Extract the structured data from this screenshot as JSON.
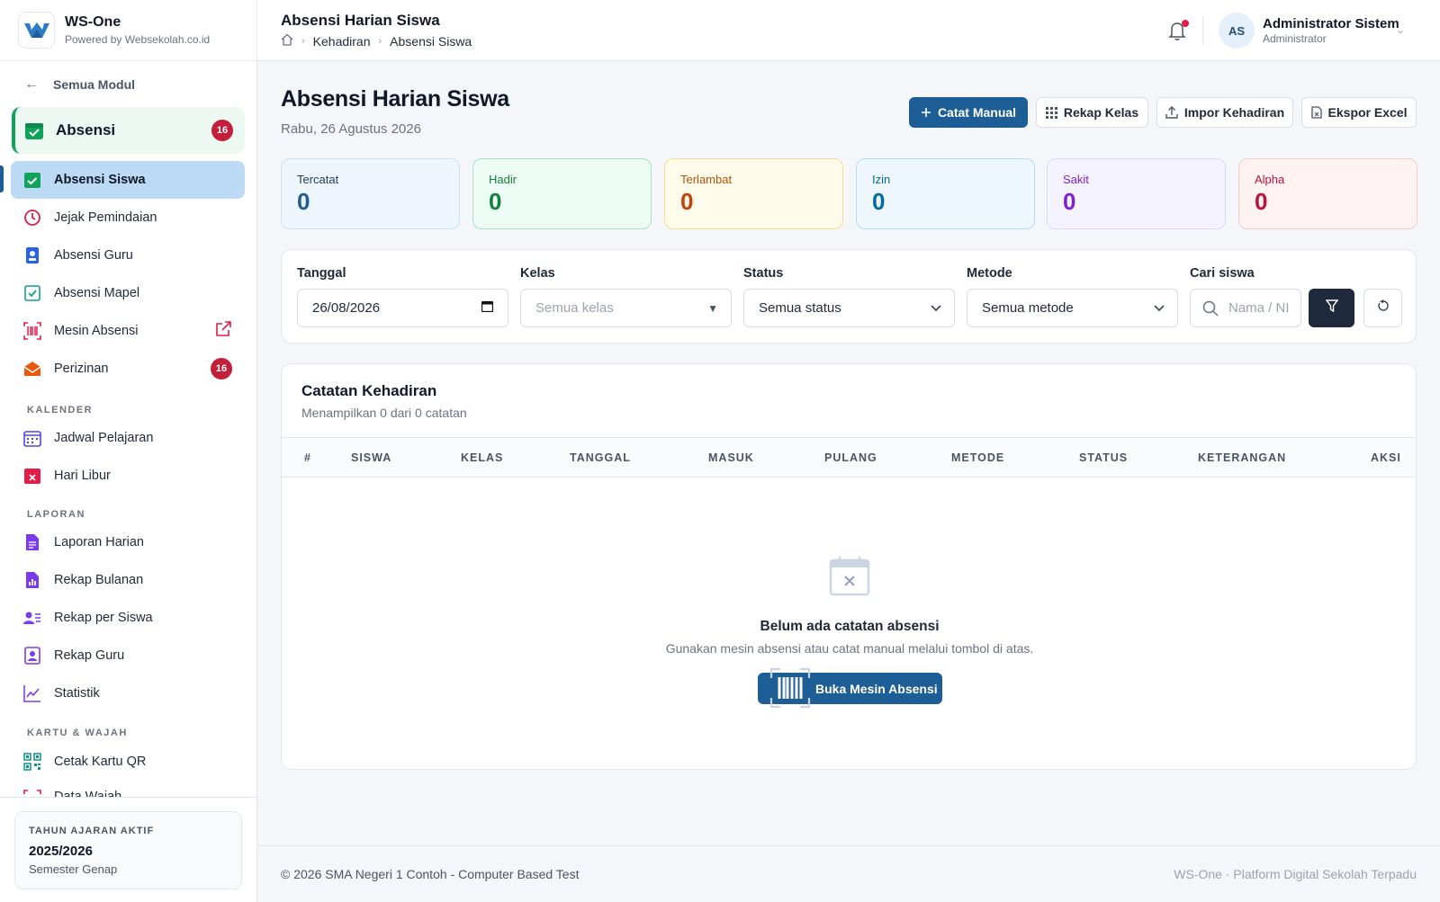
{
  "brand": {
    "name": "WS-One",
    "tagline": "Powered by Websekolah.co.id"
  },
  "sidebar": {
    "back_label": "Semua Modul",
    "module": {
      "label": "Absensi",
      "badge": "16"
    },
    "items": [
      {
        "label": "Absensi Siswa",
        "icon": "calendar-check-icon",
        "active": true
      },
      {
        "label": "Jejak Pemindaian",
        "icon": "clock-icon"
      },
      {
        "label": "Absensi Guru",
        "icon": "id-badge-icon"
      },
      {
        "label": "Absensi Mapel",
        "icon": "checklist-icon"
      },
      {
        "label": "Mesin Absensi",
        "icon": "barcode-scanner-icon"
      },
      {
        "label": "Perizinan",
        "icon": "envelope-open-icon",
        "badge": "16"
      }
    ],
    "section_kalender": "KALENDER",
    "kalender_items": [
      {
        "label": "Jadwal Pelajaran",
        "icon": "calendar-grid-icon"
      },
      {
        "label": "Hari Libur",
        "icon": "calendar-x-icon"
      }
    ],
    "section_laporan": "LAPORAN",
    "laporan_items": [
      {
        "label": "Laporan Harian",
        "icon": "document-icon"
      },
      {
        "label": "Rekap Bulanan",
        "icon": "bar-chart-icon"
      },
      {
        "label": "Rekap per Siswa",
        "icon": "user-list-icon"
      },
      {
        "label": "Rekap Guru",
        "icon": "contact-card-icon"
      },
      {
        "label": "Statistik",
        "icon": "line-chart-icon"
      }
    ],
    "section_kartu": "KARTU & WAJAH",
    "kartu_items": [
      {
        "label": "Cetak Kartu QR",
        "icon": "qr-code-icon"
      },
      {
        "label": "Data Wajah",
        "icon": "face-scan-icon"
      }
    ],
    "year_card": {
      "title": "TAHUN AJARAN AKTIF",
      "value": "2025/2026",
      "semester": "Semester Genap"
    }
  },
  "topbar": {
    "title": "Absensi Harian Siswa",
    "breadcrumb": [
      "Kehadiran",
      "Absensi Siswa"
    ],
    "user": {
      "initials": "AS",
      "name": "Administrator Sistem",
      "role": "Administrator"
    }
  },
  "page": {
    "title": "Absensi Harian Siswa",
    "date": "Rabu, 26 Agustus 2026",
    "actions": {
      "manual": "Catat Manual",
      "rekap": "Rekap Kelas",
      "impor": "Impor Kehadiran",
      "ekspor": "Ekspor Excel"
    }
  },
  "stats": [
    {
      "label": "Tercatat",
      "value": "0",
      "bg": "#eef5fc",
      "border": "#cfe0f1",
      "label_color": "#1e3a5f",
      "value_color": "#1d5e96"
    },
    {
      "label": "Hadir",
      "value": "0",
      "bg": "#ecfbf3",
      "border": "#a7e3c4",
      "label_color": "#15803d",
      "value_color": "#15803d"
    },
    {
      "label": "Terlambat",
      "value": "0",
      "bg": "#fffbeb",
      "border": "#f7dc8e",
      "label_color": "#b45309",
      "value_color": "#c2410c"
    },
    {
      "label": "Izin",
      "value": "0",
      "bg": "#eef7fd",
      "border": "#b6dcf3",
      "label_color": "#0369a1",
      "value_color": "#0369a1"
    },
    {
      "label": "Sakit",
      "value": "0",
      "bg": "#f5f3ff",
      "border": "#ddd6fe",
      "label_color": "#7e22ce",
      "value_color": "#7e22ce"
    },
    {
      "label": "Alpha",
      "value": "0",
      "bg": "#fef2f2",
      "border": "#fbcaca",
      "label_color": "#be123c",
      "value_color": "#be123c"
    }
  ],
  "filters": {
    "tanggal": {
      "label": "Tanggal",
      "value": "26/08/2026"
    },
    "kelas": {
      "label": "Kelas",
      "placeholder": "Semua kelas"
    },
    "status": {
      "label": "Status",
      "value": "Semua status"
    },
    "metode": {
      "label": "Metode",
      "value": "Semua metode"
    },
    "cari": {
      "label": "Cari siswa",
      "placeholder": "Nama / NI"
    }
  },
  "table": {
    "title": "Catatan Kehadiran",
    "subtitle": "Menampilkan 0 dari 0 catatan",
    "columns": [
      "#",
      "SISWA",
      "KELAS",
      "TANGGAL",
      "MASUK",
      "PULANG",
      "METODE",
      "STATUS",
      "KETERANGAN",
      "AKSI"
    ],
    "rows": [],
    "empty": {
      "title": "Belum ada catatan absensi",
      "subtitle": "Gunakan mesin absensi atau catat manual melalui tombol di atas.",
      "button": "Buka Mesin Absensi"
    }
  },
  "footer": {
    "left": "© 2026 SMA Negeri 1 Contoh - Computer Based Test",
    "right": "WS-One · Platform Digital Sekolah Terpadu"
  }
}
